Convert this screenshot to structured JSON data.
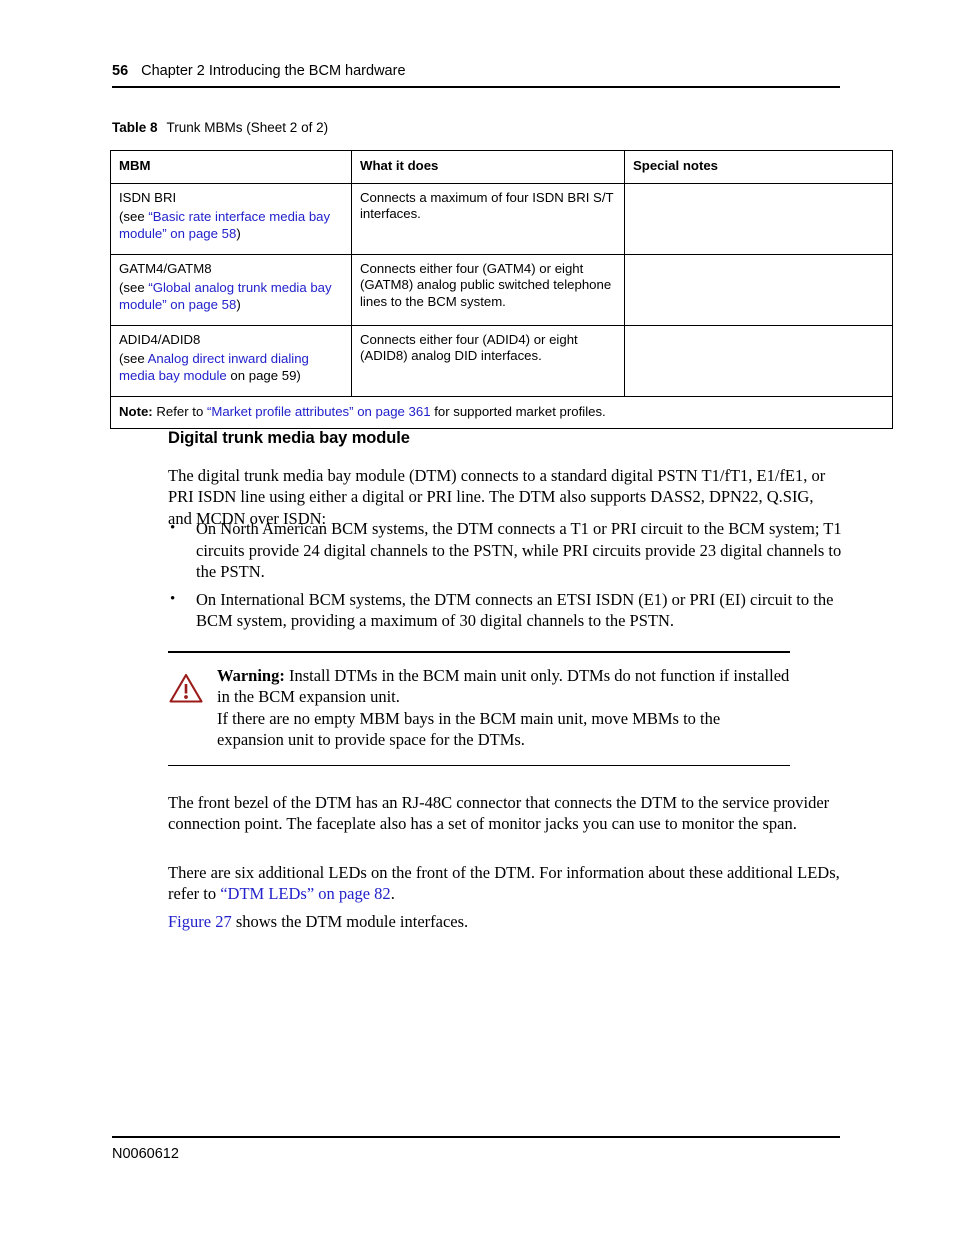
{
  "header": {
    "page_number": "56",
    "chapter_title": "Chapter 2  Introducing the BCM hardware"
  },
  "table": {
    "caption_label": "Table 8",
    "caption_text": "Trunk MBMs (Sheet 2 of 2)",
    "columns": [
      "MBM",
      "What it does",
      "Special notes"
    ],
    "rows": [
      {
        "mbm_name": "ISDN BRI",
        "ref_prefix": "(see ",
        "ref_link": "“Basic rate interface media bay module” on page 58",
        "ref_suffix": ")",
        "what_it_does": "Connects a maximum of four ISDN BRI S/T interfaces.",
        "special_notes": ""
      },
      {
        "mbm_name": "GATM4/GATM8",
        "ref_prefix": "(see ",
        "ref_link": "“Global analog trunk media bay module” on page 58",
        "ref_suffix": ")",
        "what_it_does": "Connects either four (GATM4) or eight (GATM8) analog public switched telephone lines to the BCM system.",
        "special_notes": ""
      },
      {
        "mbm_name": "ADID4/ADID8",
        "ref_prefix": "(see ",
        "ref_link": "Analog direct inward dialing media bay module",
        "ref_suffix": " on page 59)",
        "what_it_does": "Connects either four (ADID4) or eight (ADID8) analog DID interfaces.",
        "special_notes": ""
      }
    ],
    "note": {
      "label": "Note:",
      "text_before": " Refer to ",
      "link": "“Market profile attributes” on page 361",
      "text_after": " for supported market profiles."
    }
  },
  "section": {
    "heading": "Digital trunk media bay module",
    "intro_paragraph": "The digital trunk media bay module (DTM) connects to a standard digital PSTN T1/fT1, E1/fE1, or PRI ISDN line using either a digital or PRI line. The DTM also supports DASS2, DPN22, Q.SIG, and MCDN over ISDN:",
    "bullets": [
      "On North American BCM systems, the DTM connects a T1 or PRI circuit to the BCM system; T1 circuits provide 24 digital channels to the PSTN, while PRI circuits provide 23 digital channels to the PSTN.",
      "On International BCM systems, the DTM connects an ETSI ISDN (E1) or PRI (EI) circuit to the BCM system, providing a maximum of 30 digital channels to the PSTN."
    ],
    "bullet_marker": "•"
  },
  "warning": {
    "label": "Warning:",
    "text_line1": " Install DTMs in the BCM main unit only. DTMs do not function if installed in the BCM expansion unit.",
    "text_line2": "If there are no empty MBM bays in the BCM main unit, move MBMs to the expansion unit to provide space for the DTMs.",
    "icon_color": "#9B1B1B"
  },
  "body": {
    "paragraph_bezel": "The front bezel of the DTM has an RJ-48C connector that connects the DTM to the service provider connection point. The faceplate also has a set of monitor jacks you can use to monitor the span.",
    "paragraph_leds_before": "There are six additional LEDs on the front of the DTM. For information about these additional LEDs, refer to ",
    "paragraph_leds_link": "“DTM LEDs” on page 82",
    "paragraph_leds_after": ".",
    "paragraph_figure_link": "Figure 27",
    "paragraph_figure_after": " shows the DTM module interfaces."
  },
  "footer": {
    "document_number": "N0060612"
  },
  "colors": {
    "link": "#2222cc",
    "text": "#000000",
    "warning": "#9B1B1B"
  }
}
